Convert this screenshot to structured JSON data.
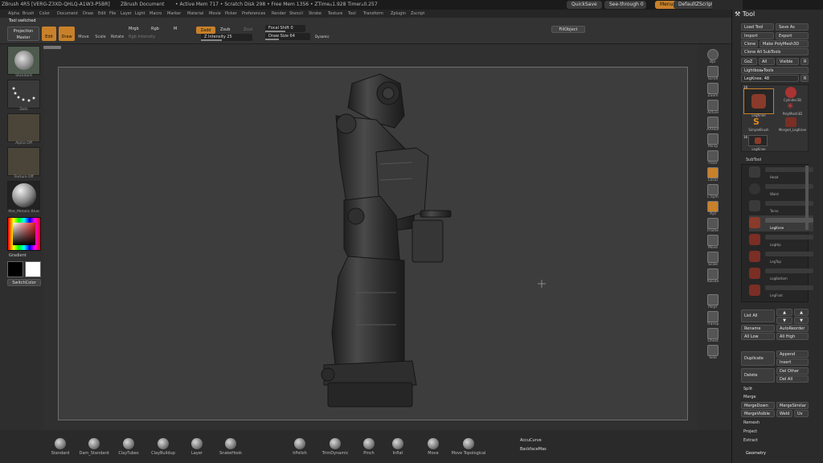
{
  "titlebar": {
    "app": "ZBrush 4R5 [VERG-Z3XD-QHLQ-A1W3-P5BR]",
    "doc": "ZBrush Document",
    "stats": "• Active Mem 717 • Scratch Disk 298 • Free Mem 1356 • ZTime▵1.928 Timer▵0.257",
    "quicksave": "QuickSave",
    "seethrough": "See-through",
    "seethrough_value": "0",
    "menus": "Menus",
    "default_script": "DefaultZScript"
  },
  "menubar": [
    "Alpha",
    "Brush",
    "Color",
    "Document",
    "Draw",
    "Edit",
    "File",
    "Layer",
    "Light",
    "Macro",
    "Marker",
    "Material",
    "Movie",
    "Picker",
    "Preferences",
    "Render",
    "Stencil",
    "Stroke",
    "Texture",
    "Tool",
    "Transform",
    "Zplugin",
    "Zscript"
  ],
  "toolbar": {
    "status": "Tool switched",
    "projection_master": "Projection Master",
    "edit": "Edit",
    "draw": "Draw",
    "move": "Move",
    "scale": "Scale",
    "rotate": "Rotate",
    "mrgb": "Mrgb",
    "rgb": "Rgb",
    "m": "M",
    "rgb_intensity": "Rgb Intensity",
    "zadd": "Zadd",
    "zsub": "Zsub",
    "zcut": "Zcut",
    "z_intensity_label": "Z Intensity",
    "z_intensity": "25",
    "focal_shift_label": "Focal Shift",
    "focal_shift": "0",
    "draw_size_label": "Draw Size",
    "draw_size": "64",
    "dynamic": "Dynamic",
    "fill_object": "FillObject"
  },
  "left_shelf": {
    "brush": "Standard",
    "stroke": "Dots",
    "alpha": "Alpha Off",
    "texture": "Texture Off",
    "material": "Mat_Metalic Blue",
    "gradient": "Gradient",
    "switch_color": "SwitchColor"
  },
  "bottom_brushes": [
    "Standard",
    "Dam_Standard",
    "ClayTubes",
    "ClayBuildup",
    "Layer",
    "SnakeHook",
    "hPolish",
    "TrimDynamic",
    "Pinch",
    "Inflat",
    "Move",
    "Move Topological"
  ],
  "bottom_right": {
    "accucurve": "AccuCurve",
    "backfacemask": "BackfaceMas"
  },
  "right_shelf": [
    "Bpr",
    "Scroll",
    "Zoom",
    "Actual",
    "AAHalf",
    "Persp",
    "Floor",
    "Local",
    "L.Sym",
    "Xyz",
    "Frame",
    "Move",
    "Scale",
    "Rotate",
    "PolyF",
    "Transp",
    "Ghost",
    "Solo"
  ],
  "tool_panel": {
    "title": "Tool",
    "load_tool": "Load Tool",
    "save_as": "Save As",
    "import": "Import",
    "export": "Export",
    "clone": "Clone",
    "make_polymesh": "Make PolyMesh3D",
    "clone_all": "Clone All SubTools",
    "goz": "GoZ",
    "all": "All",
    "visible": "Visible",
    "r": "R",
    "lightbox_tools": "Lightbox▸Tools",
    "current_tool": "LegKnee.",
    "current_tool_value": "48",
    "tool_thumbs": [
      "LegKnee",
      "Cylinder3D",
      "SimpleBrush",
      "PolyMesh3D",
      "Merged_LegKnee",
      "LegKnee"
    ],
    "thumb_counts": [
      "16",
      "16"
    ],
    "subtool_header": "SubTool",
    "subtools": [
      "Head",
      "Waist",
      "Torso",
      "LegKnee",
      "LegHip",
      "LegTop",
      "LegBottom",
      "LegFoot"
    ],
    "list_all": "List All",
    "rename": "Rename",
    "auto_reorder": "AutoReorder",
    "all_low": "All Low",
    "all_high": "All High",
    "duplicate": "Duplicate",
    "append": "Append",
    "insert": "Insert",
    "delete": "Delete",
    "del_other": "Del Other",
    "del_all": "Del All",
    "split": "Split",
    "merge": "Merge",
    "merge_down": "MergeDown",
    "merge_similar": "MergeSimilar",
    "merge_visible": "MergeVisible",
    "weld": "Weld",
    "uv": "Uv",
    "remesh": "Remesh",
    "project": "Project",
    "extract": "Extract",
    "geometry": "Geometry"
  }
}
